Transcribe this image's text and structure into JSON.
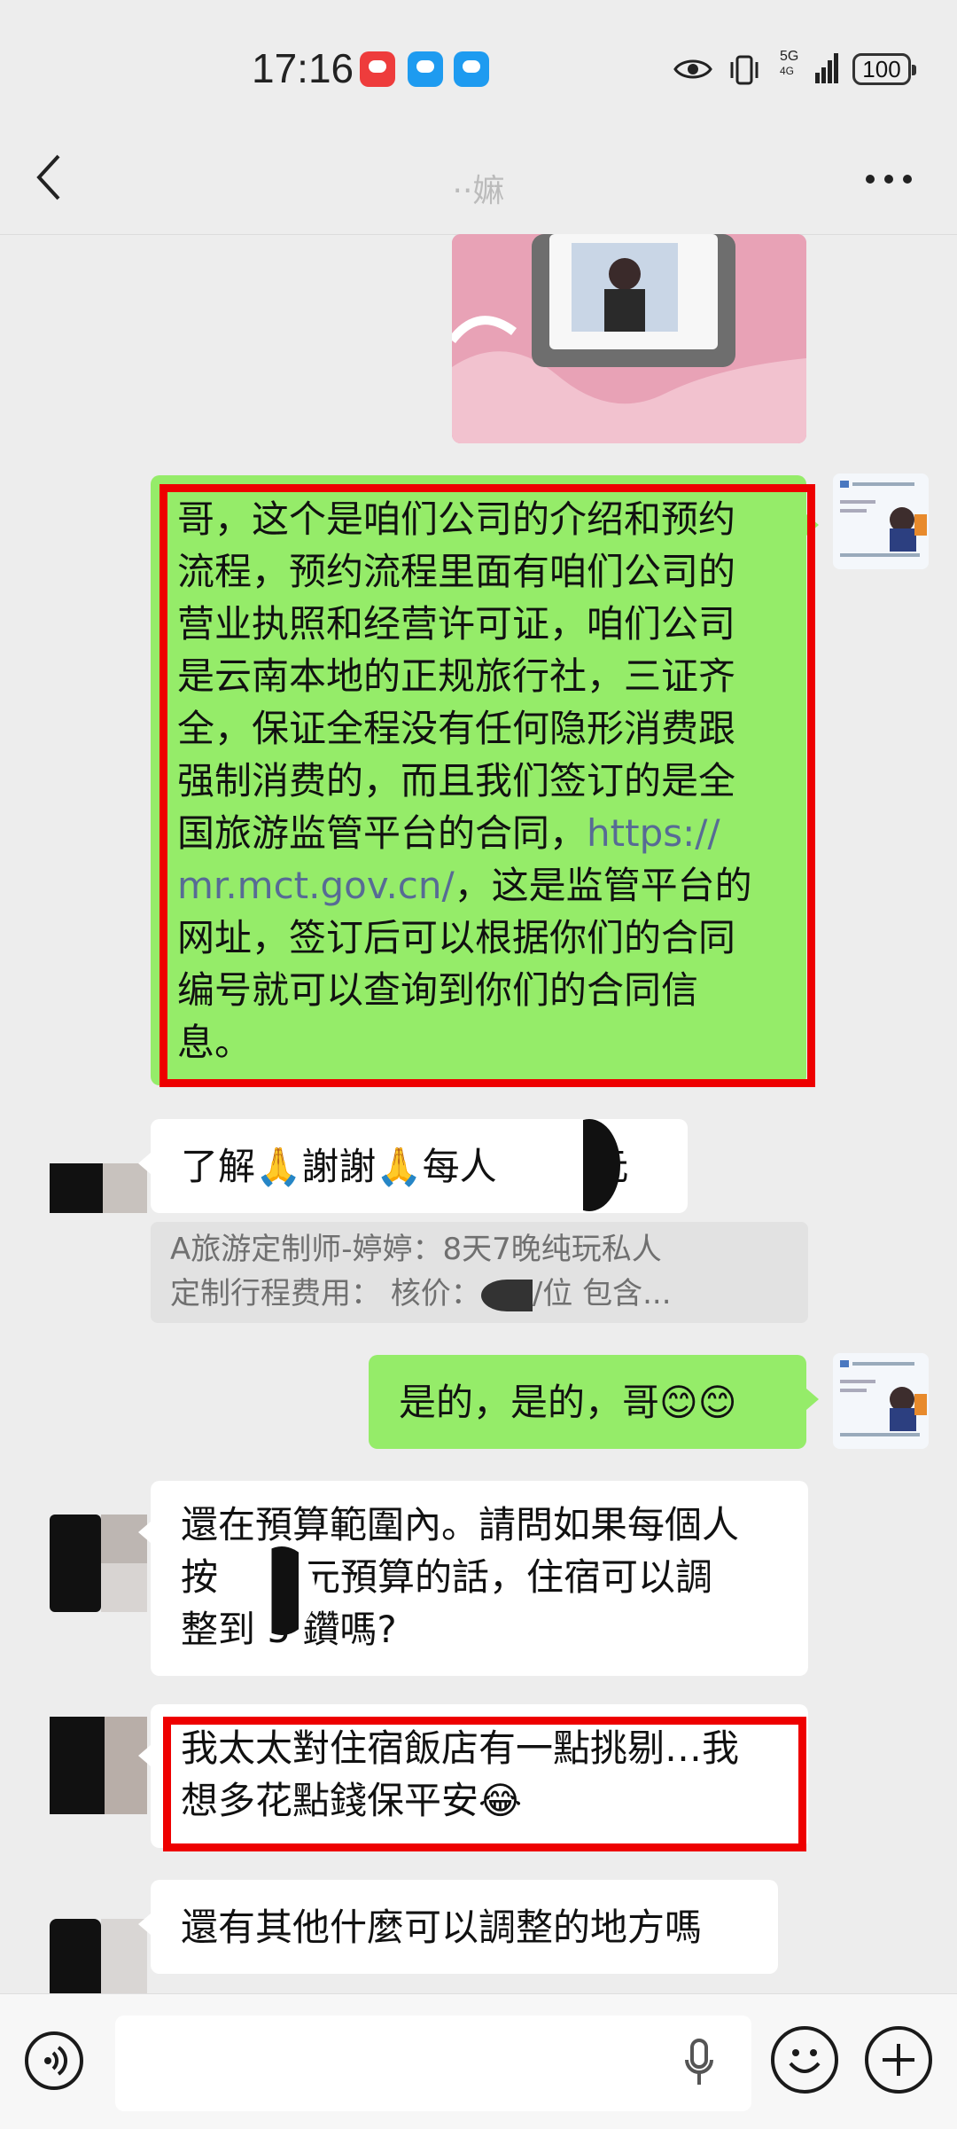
{
  "status_bar": {
    "time": "17:16",
    "network": "5G",
    "network_sub": "4G",
    "battery": "100",
    "icons": [
      "huawei-app-icon",
      "message-app-icon",
      "weather-app-icon",
      "eye-icon",
      "vibrate-icon",
      "signal-icon",
      "battery-icon"
    ]
  },
  "header": {
    "title": "··嫲",
    "back_icon": "chevron-left-icon",
    "more_icon": "more-dots-icon"
  },
  "messages": [
    {
      "from": "me",
      "lines": [
        "哥，这个是咱们公司的介绍和预约",
        "流程，预约流程里面有咱们公司的",
        "营业执照和经营许可证，咱们公司",
        "是云南本地的正规旅行社，三证齐",
        "全，保证全程没有任何隐形消费跟",
        "强制消费的，而且我们签订的是全",
        "国旅游监管平台的合同，",
        "，这是监管平台的",
        "网址，签订后可以根据你们的合同",
        "编号就可以查询到你们的合同信",
        "息。"
      ],
      "link_part1": "https://",
      "link_part2": "mr.mct.gov.cn/"
    },
    {
      "from": "other",
      "text_a": "了解🙏謝謝🙏每人",
      "text_b": "0元"
    },
    {
      "from": "quote",
      "line1": "A旅游定制师-婷婷：8天7晚纯玩私人",
      "line2a": "定制行程费用：   核价：",
      "line2b": "/位 包含..."
    },
    {
      "from": "me",
      "text": "是的，是的，哥😊😊"
    },
    {
      "from": "other",
      "line1": "還在預算範圍內。請問如果每個人",
      "line2a": "按",
      "line2b": "元預算的話，住宿可以調",
      "line3": "整到 5 鑽嗎?"
    },
    {
      "from": "other",
      "line1": "我太太對住宿飯店有一點挑剔…我",
      "line2": "想多花點錢保平安😂"
    },
    {
      "from": "other",
      "text": "還有其他什麼可以調整的地方嗎"
    }
  ],
  "input_bar": {
    "voice_icon": "voice-icon",
    "mic_icon": "microphone-icon",
    "emoji_icon": "emoji-icon",
    "plus_icon": "plus-icon",
    "placeholder": ""
  },
  "colors": {
    "background": "#ededed",
    "my_bubble": "#95ec69",
    "other_bubble": "#ffffff",
    "highlight": "#ee0000",
    "link": "#576b95"
  }
}
